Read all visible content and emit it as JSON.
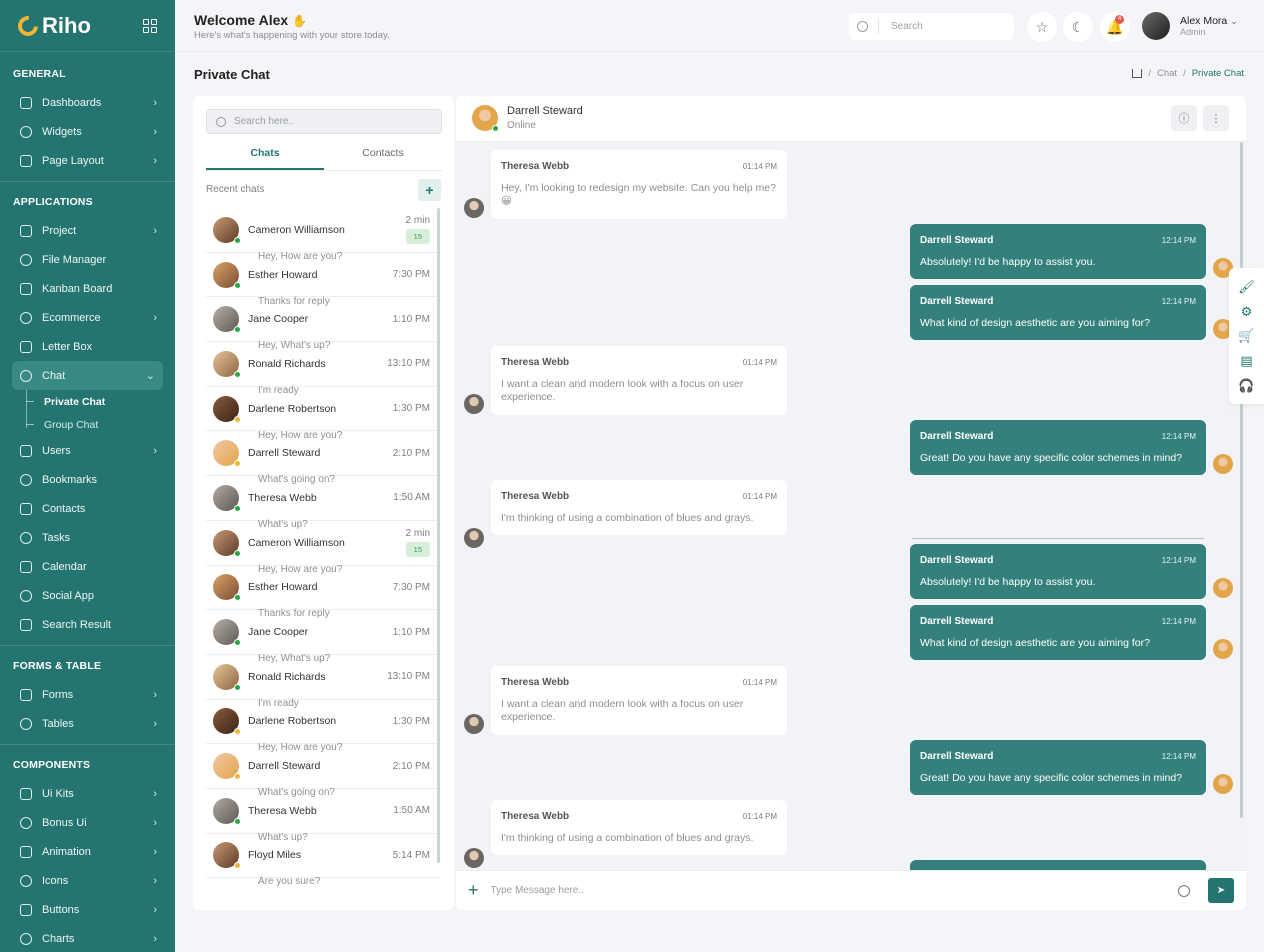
{
  "brand": {
    "name": "Riho"
  },
  "sidebar": {
    "sections": [
      {
        "title": "GENERAL",
        "items": [
          {
            "label": "Dashboards",
            "icon": "home-icon",
            "chevron": true
          },
          {
            "label": "Widgets",
            "icon": "widgets-icon",
            "chevron": true
          },
          {
            "label": "Page Layout",
            "icon": "layout-icon",
            "chevron": true
          }
        ]
      },
      {
        "title": "APPLICATIONS",
        "items": [
          {
            "label": "Project",
            "icon": "project-icon",
            "chevron": true
          },
          {
            "label": "File Manager",
            "icon": "folder-icon",
            "chevron": false
          },
          {
            "label": "Kanban Board",
            "icon": "kanban-icon",
            "chevron": false
          },
          {
            "label": "Ecommerce",
            "icon": "shop-icon",
            "chevron": true
          },
          {
            "label": "Letter Box",
            "icon": "mail-icon",
            "chevron": false
          },
          {
            "label": "Chat",
            "icon": "chat-icon",
            "chevron": true,
            "active": true
          },
          {
            "label": "Users",
            "icon": "users-icon",
            "chevron": true
          },
          {
            "label": "Bookmarks",
            "icon": "heart-icon",
            "chevron": false
          },
          {
            "label": "Contacts",
            "icon": "phone-icon",
            "chevron": false
          },
          {
            "label": "Tasks",
            "icon": "tasks-icon",
            "chevron": false
          },
          {
            "label": "Calendar",
            "icon": "calendar-icon",
            "chevron": false
          },
          {
            "label": "Social App",
            "icon": "social-icon",
            "chevron": false
          },
          {
            "label": "Search Result",
            "icon": "search-icon",
            "chevron": false
          }
        ]
      },
      {
        "title": "FORMS & TABLE",
        "items": [
          {
            "label": "Forms",
            "icon": "forms-icon",
            "chevron": true
          },
          {
            "label": "Tables",
            "icon": "table-icon",
            "chevron": true
          }
        ]
      },
      {
        "title": "COMPONENTS",
        "items": [
          {
            "label": "Ui Kits",
            "icon": "ui-kits-icon",
            "chevron": true
          },
          {
            "label": "Bonus Ui",
            "icon": "bonus-icon",
            "chevron": true
          },
          {
            "label": "Animation",
            "icon": "animation-icon",
            "chevron": true
          },
          {
            "label": "Icons",
            "icon": "icons-icon",
            "chevron": true
          },
          {
            "label": "Buttons",
            "icon": "buttons-icon",
            "chevron": true
          },
          {
            "label": "Charts",
            "icon": "charts-icon",
            "chevron": true
          }
        ]
      }
    ],
    "chat_submenu": [
      "Private Chat",
      "Group Chat"
    ]
  },
  "header": {
    "welcome": "Welcome Alex",
    "subtitle": "Here's what's happening with your store today.",
    "search_placeholder": "Search",
    "notification_count": "4",
    "user_name": "Alex Mora",
    "user_role": "Admin"
  },
  "page": {
    "title": "Private Chat",
    "breadcrumb": [
      "Chat",
      "Private Chat"
    ]
  },
  "contacts": {
    "search_placeholder": "Search here..",
    "tabs": [
      "Chats",
      "Contacts"
    ],
    "recent_label": "Recent chats",
    "list": [
      {
        "name": "Cameron Williamson",
        "message": "Hey, How are you?",
        "time": "2 min",
        "count": "15",
        "status": "#28a745"
      },
      {
        "name": "Esther Howard",
        "message": "Thanks for reply",
        "time": "7:30 PM",
        "status": "#28a745"
      },
      {
        "name": "Jane Cooper",
        "message": "Hey, What's up?",
        "time": "1:10 PM",
        "status": "#28a745"
      },
      {
        "name": "Ronald Richards",
        "message": "I'm ready",
        "time": "13:10 PM",
        "status": "#28a745"
      },
      {
        "name": "Darlene Robertson",
        "message": "Hey, How are you?",
        "time": "1:30 PM",
        "status": "#f3b436"
      },
      {
        "name": "Darrell Steward",
        "message": "What's going on?",
        "time": "2:10 PM",
        "status": "#f3b436"
      },
      {
        "name": "Theresa Webb",
        "message": "What's up?",
        "time": "1:50 AM",
        "status": "#28a745"
      },
      {
        "name": "Cameron Williamson",
        "message": "Hey, How are you?",
        "time": "2 min",
        "count": "15",
        "status": "#28a745"
      },
      {
        "name": "Esther Howard",
        "message": "Thanks for reply",
        "time": "7:30 PM",
        "status": "#28a745"
      },
      {
        "name": "Jane Cooper",
        "message": "Hey, What's up?",
        "time": "1:10 PM",
        "status": "#28a745"
      },
      {
        "name": "Ronald Richards",
        "message": "I'm ready",
        "time": "13:10 PM",
        "status": "#28a745"
      },
      {
        "name": "Darlene Robertson",
        "message": "Hey, How are you?",
        "time": "1:30 PM",
        "status": "#f3b436"
      },
      {
        "name": "Darrell Steward",
        "message": "What's going on?",
        "time": "2:10 PM",
        "status": "#f3b436"
      },
      {
        "name": "Theresa Webb",
        "message": "What's up?",
        "time": "1:50 AM",
        "status": "#28a745"
      },
      {
        "name": "Floyd Miles",
        "message": "Are you sure?",
        "time": "5:14 PM",
        "status": "#f3b436"
      }
    ]
  },
  "chat": {
    "contact_name": "Darrell Steward",
    "contact_status": "Online",
    "input_placeholder": "Type Message here..",
    "messages": [
      {
        "dir": "in",
        "author": "Theresa Webb",
        "time": "01:14 PM",
        "text": "Hey, I'm looking to redesign my website. Can you help me? 😀"
      },
      {
        "dir": "out",
        "author": "Darrell Steward",
        "time": "12:14 PM",
        "text": "Absolutely! I'd be happy to assist you."
      },
      {
        "dir": "out",
        "author": "Darrell Steward",
        "time": "12:14 PM",
        "text": "What kind of design aesthetic are you aiming for?"
      },
      {
        "dir": "in",
        "author": "Theresa Webb",
        "time": "01:14 PM",
        "text": "I want a clean and modern look with a focus on user experience."
      },
      {
        "dir": "out",
        "author": "Darrell Steward",
        "time": "12:14 PM",
        "text": "Great! Do you have any specific color schemes in mind?"
      },
      {
        "dir": "in",
        "author": "Theresa Webb",
        "time": "01:14 PM",
        "text": "I'm thinking of using a combination of blues and grays."
      },
      {
        "dir": "out",
        "author": "Darrell Steward",
        "time": "12:14 PM",
        "text": "Absolutely! I'd be happy to assist you."
      },
      {
        "dir": "out",
        "author": "Darrell Steward",
        "time": "12:14 PM",
        "text": "What kind of design aesthetic are you aiming for?"
      },
      {
        "dir": "in",
        "author": "Theresa Webb",
        "time": "01:14 PM",
        "text": "I want a clean and modern look with a focus on user experience."
      },
      {
        "dir": "out",
        "author": "Darrell Steward",
        "time": "12:14 PM",
        "text": "Great! Do you have any specific color schemes in mind?"
      },
      {
        "dir": "in",
        "author": "Theresa Webb",
        "time": "01:14 PM",
        "text": "I'm thinking of using a combination of blues and grays."
      }
    ]
  },
  "colors": {
    "primary": "#24756f",
    "bubble_out": "#34817b",
    "online": "#28a745",
    "away": "#f3b436",
    "badge": "#e85b4a"
  },
  "right_tools": [
    "paint-roller-icon",
    "gear-icon",
    "cart-icon",
    "layout-icon",
    "headset-icon"
  ]
}
